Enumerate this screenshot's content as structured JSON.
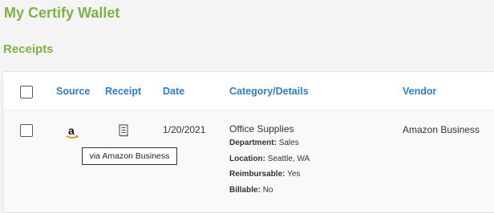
{
  "app": {
    "title": "My Certify Wallet"
  },
  "section": {
    "title": "Receipts"
  },
  "table": {
    "headers": {
      "source": "Source",
      "receipt": "Receipt",
      "date": "Date",
      "category": "Category/Details",
      "vendor": "Vendor"
    },
    "rows": [
      {
        "source_icon": "amazon-icon",
        "receipt_icon": "receipt-icon",
        "date": "1/20/2021",
        "category": "Office Supplies",
        "details": [
          {
            "label": "Department:",
            "value": "Sales"
          },
          {
            "label": "Location:",
            "value": "Seattle, WA"
          },
          {
            "label": "Reimbursable:",
            "value": "Yes"
          },
          {
            "label": "Billable:",
            "value": "No"
          }
        ],
        "vendor": "Amazon Business"
      }
    ]
  },
  "tooltip": {
    "text": "via Amazon Business"
  },
  "colors": {
    "accent_green": "#7cb342",
    "link_blue": "#2e7bd6"
  }
}
